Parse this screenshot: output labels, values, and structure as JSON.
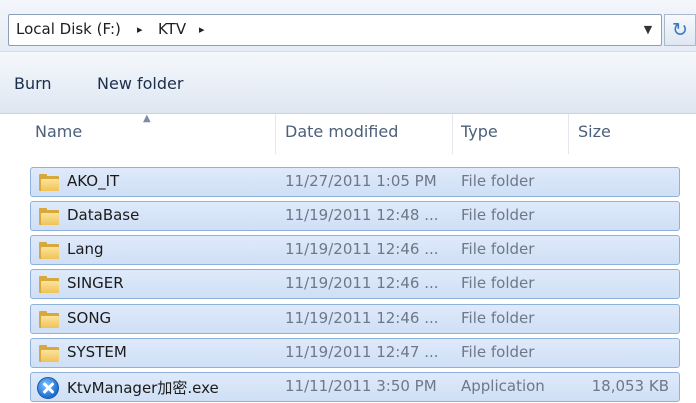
{
  "address_bar": {
    "crumbs": [
      "Local Disk (F:)",
      "KTV"
    ],
    "separator": "▸",
    "dropdown_icon": "chevron-down-icon",
    "refresh_icon": "refresh-icon",
    "dropdown_glyph": "▼",
    "refresh_glyph": "↻"
  },
  "toolbar": {
    "burn_label": "Burn",
    "new_folder_label": "New folder"
  },
  "columns": {
    "name": "Name",
    "date_modified": "Date modified",
    "type": "Type",
    "size": "Size",
    "sort_glyph": "▲"
  },
  "files": [
    {
      "name": "AKO_IT",
      "date": "11/27/2011 1:05 PM",
      "type": "File folder",
      "size": "",
      "icon": "folder-icon"
    },
    {
      "name": "DataBase",
      "date": "11/19/2011 12:48 ...",
      "type": "File folder",
      "size": "",
      "icon": "folder-icon"
    },
    {
      "name": "Lang",
      "date": "11/19/2011 12:46 ...",
      "type": "File folder",
      "size": "",
      "icon": "folder-icon"
    },
    {
      "name": "SINGER",
      "date": "11/19/2011 12:46 ...",
      "type": "File folder",
      "size": "",
      "icon": "folder-icon"
    },
    {
      "name": "SONG",
      "date": "11/19/2011 12:46 ...",
      "type": "File folder",
      "size": "",
      "icon": "folder-icon"
    },
    {
      "name": "SYSTEM",
      "date": "11/19/2011 12:47 ...",
      "type": "File folder",
      "size": "",
      "icon": "folder-icon"
    },
    {
      "name": "KtvManager加密.exe",
      "date": "11/11/2011 3:50 PM",
      "type": "Application",
      "size": "18,053 KB",
      "icon": "app-icon"
    }
  ],
  "colors": {
    "selection_fill": "#cfdff5",
    "selection_border": "#8fb2dc",
    "folder": "#f0c357"
  }
}
